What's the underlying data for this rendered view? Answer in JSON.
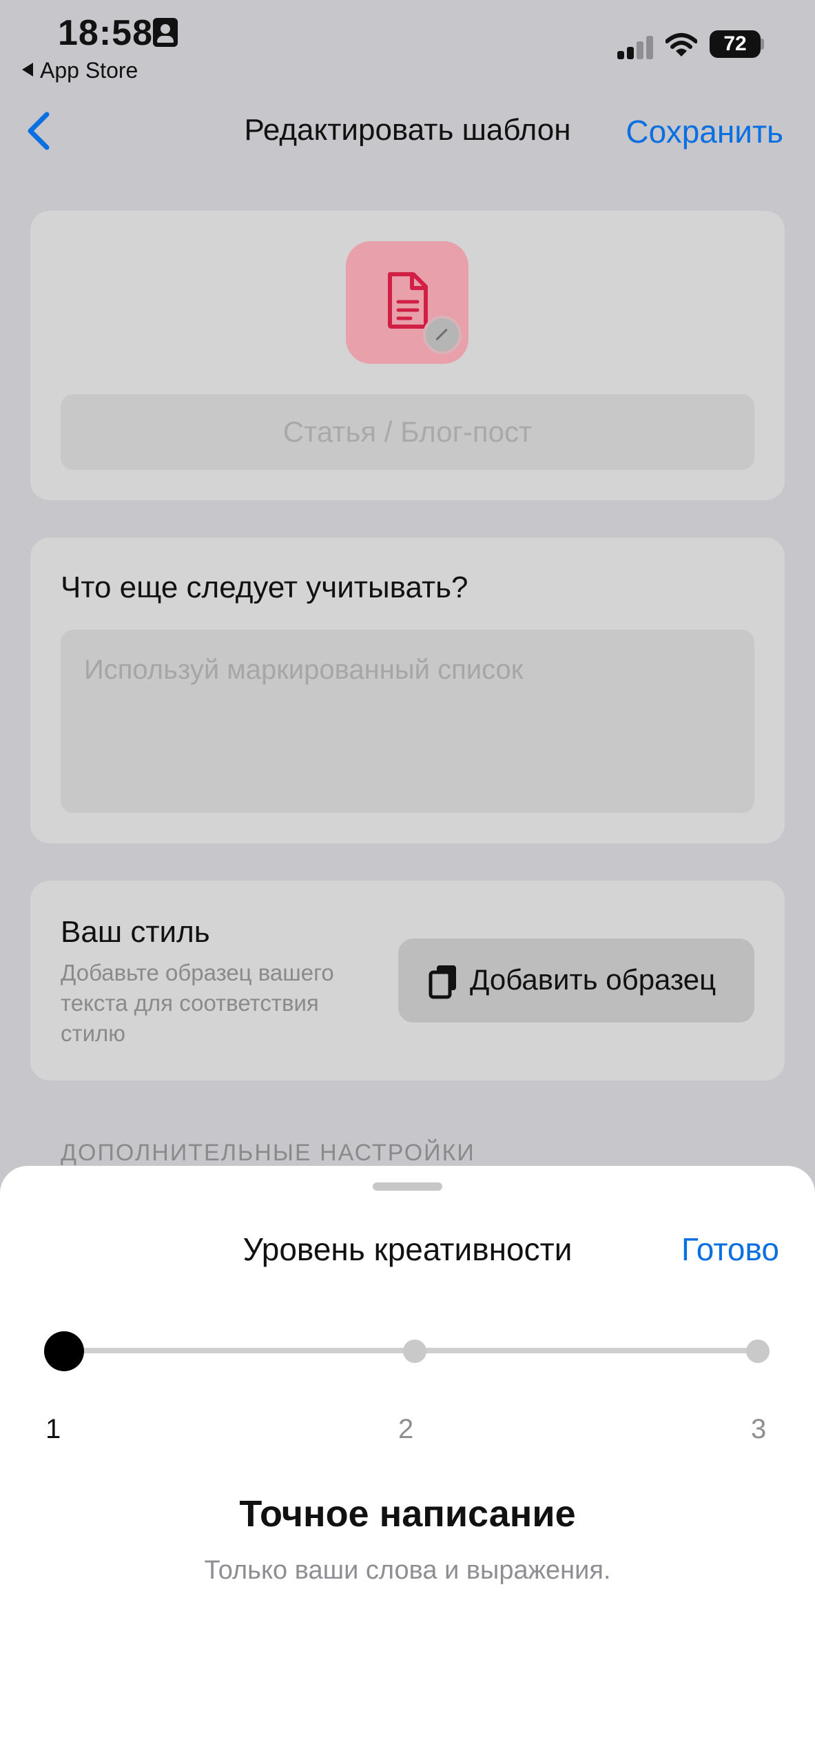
{
  "status_bar": {
    "time": "18:58",
    "back_app": "App Store",
    "battery": "72",
    "icons": [
      "id-card-icon",
      "signal-icon",
      "wifi-icon",
      "battery-icon"
    ]
  },
  "nav": {
    "back_icon": "chevron-left-icon",
    "title": "Редактировать шаблон",
    "save": "Сохранить",
    "accent_color": "#0a6fe0"
  },
  "template_card": {
    "icon": "document-icon",
    "edit_icon": "pencil-icon",
    "icon_color": "#d11f45",
    "name_placeholder": "Статья / Блог-пост"
  },
  "considerations_card": {
    "title": "Что еще следует учитывать?",
    "placeholder": "Используй маркированный список"
  },
  "style_card": {
    "title": "Ваш стиль",
    "description": "Добавьте образец вашего текста для соответствия стилю",
    "button_label": "Добавить образец",
    "button_icon": "copy-document-icon"
  },
  "additional_settings": {
    "header": "ДОПОЛНИТЕЛЬНЫЕ НАСТРОЙКИ"
  },
  "sheet": {
    "title": "Уровень креативности",
    "done": "Готово",
    "slider": {
      "value": 1,
      "min": 1,
      "max": 3,
      "ticks": [
        "1",
        "2",
        "3"
      ]
    },
    "level_title": "Точное написание",
    "level_description": "Только ваши слова и выражения."
  }
}
